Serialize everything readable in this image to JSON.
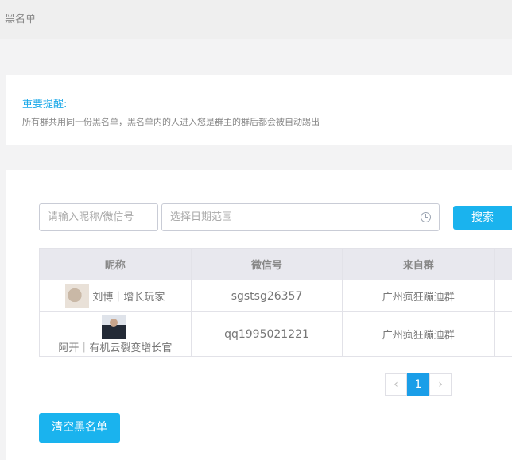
{
  "header": {
    "title": "黑名单"
  },
  "notice": {
    "title": "重要提醒:",
    "text": "所有群共用同一份黑名单，黑名单内的人进入您是群主的群后都会被自动踢出"
  },
  "filters": {
    "nick_placeholder": "请输入昵称/微信号",
    "date_placeholder": "选择日期范围",
    "search_label": "搜索"
  },
  "table": {
    "columns": [
      "昵称",
      "微信号",
      "来自群",
      ""
    ],
    "rows": [
      {
        "nick": "刘博｜增长玩家",
        "wechat": "sgstsg26357",
        "group": "广州疯狂蹦迪群"
      },
      {
        "nick": "阿开｜有机云裂变增长官",
        "wechat": "qq1995021221",
        "group": "广州疯狂蹦迪群"
      }
    ]
  },
  "pagination": {
    "prev": "‹",
    "current": "1",
    "next": "›"
  },
  "actions": {
    "clear_label": "清空黑名单"
  }
}
